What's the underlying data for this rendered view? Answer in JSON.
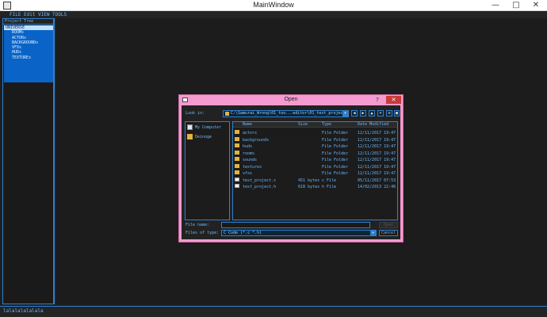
{
  "window": {
    "title": "MainWindow",
    "minimize": "—",
    "maximize": "□",
    "close": "✕"
  },
  "menu": [
    "FILE",
    "Edit",
    "VIEW",
    "TOOLS"
  ],
  "tree": {
    "header": "Project Tree",
    "root": "UNIVERSE",
    "items": [
      "ROOMs",
      "ACTORs",
      "BACKGROUNDs",
      "VFXs",
      "HUDs",
      "TEXTUREs"
    ]
  },
  "status": {
    "text": "lalalalalalala"
  },
  "dialog": {
    "title": "Open",
    "help": "?",
    "close": "✕",
    "look_in_label": "Look in:",
    "look_in_value": "C:\\Samurai_Wrong\\01_too...editor\\01_test_project",
    "sidebar": [
      "My Computer",
      "Deinoge"
    ],
    "columns": {
      "name": "Name",
      "size": "Size",
      "type": "Type",
      "date": "Date Modified"
    },
    "files": [
      {
        "name": "actors",
        "size": "",
        "type": "File Folder",
        "date": "12/11/2017 19:47",
        "kind": "folder"
      },
      {
        "name": "backgrounds",
        "size": "",
        "type": "File Folder",
        "date": "12/11/2017 19:47",
        "kind": "folder"
      },
      {
        "name": "huds",
        "size": "",
        "type": "File Folder",
        "date": "12/11/2017 19:47",
        "kind": "folder"
      },
      {
        "name": "rooms",
        "size": "",
        "type": "File Folder",
        "date": "12/11/2017 19:47",
        "kind": "folder"
      },
      {
        "name": "sounds",
        "size": "",
        "type": "File Folder",
        "date": "12/11/2017 19:47",
        "kind": "folder"
      },
      {
        "name": "textures",
        "size": "",
        "type": "File Folder",
        "date": "12/11/2017 19:47",
        "kind": "folder"
      },
      {
        "name": "vfxs",
        "size": "",
        "type": "File Folder",
        "date": "12/11/2017 19:47",
        "kind": "folder"
      },
      {
        "name": "test_project.c",
        "size": "451 bytes",
        "type": "c File",
        "date": "05/11/2017 07:53",
        "kind": "file"
      },
      {
        "name": "test_project.h",
        "size": "618 bytes",
        "type": "h File",
        "date": "14/02/2013 22:46",
        "kind": "file"
      }
    ],
    "filename_label": "File name:",
    "filename_value": "",
    "filetype_label": "Files of type:",
    "filetype_value": "C Code (*.c *.h)",
    "open_label": "Open",
    "cancel_label": "Cancel"
  },
  "colors": {
    "accent": "#2f7fcf",
    "text": "#6bb8ff",
    "dialog_frame": "#f49ad0",
    "selection": "#0a64c8"
  }
}
